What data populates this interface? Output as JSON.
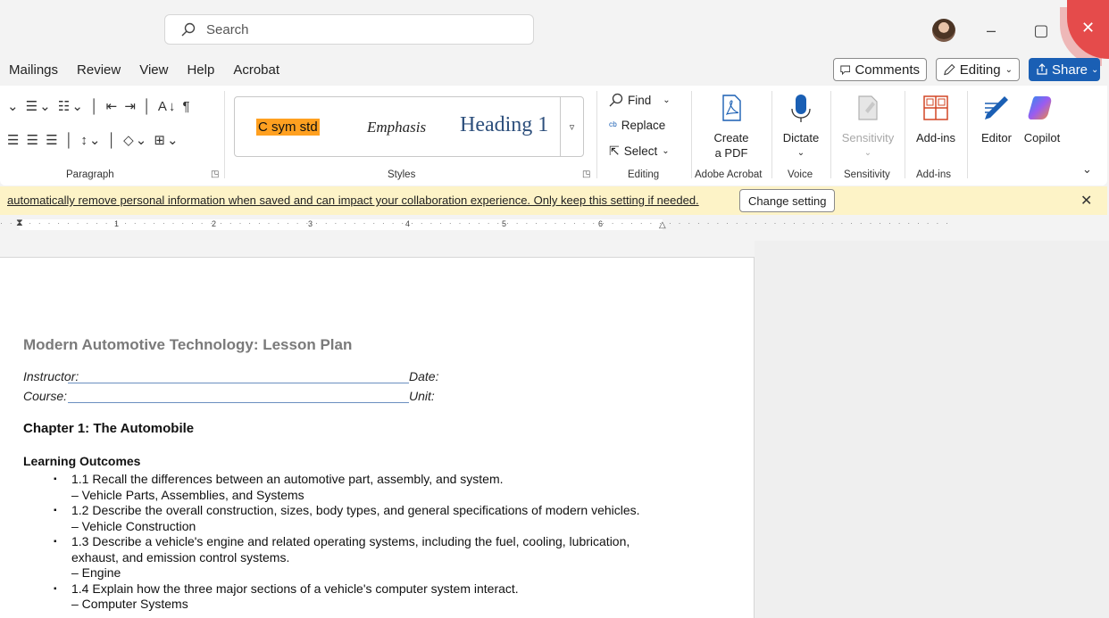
{
  "titlebar": {
    "search_placeholder": "Search",
    "minimize": "–",
    "maximize": "▢",
    "close": "✕"
  },
  "menu": {
    "items": [
      "Mailings",
      "Review",
      "View",
      "Help",
      "Acrobat"
    ],
    "comments": "Comments",
    "editing": "Editing",
    "share": "Share"
  },
  "ribbon": {
    "paragraph_label": "Paragraph",
    "styles_label": "Styles",
    "styles": [
      "C sym std",
      "Emphasis",
      "Heading 1"
    ],
    "editing_label": "Editing",
    "find": "Find",
    "replace": "Replace",
    "select": "Select",
    "create_pdf": [
      "Create",
      "a PDF"
    ],
    "adobe_label": "Adobe Acrobat",
    "dictate": "Dictate",
    "voice_label": "Voice",
    "sensitivity": "Sensitivity",
    "sensitivity_label": "Sensitivity",
    "addins": "Add-ins",
    "addins_label": "Add-ins",
    "editor": "Editor",
    "copilot": "Copilot",
    "colors": {
      "accent": "#1a5fb4",
      "highlight": "#ffa020",
      "close": "#e54b4b"
    }
  },
  "infobar": {
    "message": "automatically remove personal information when saved and can impact your collaboration experience. Only keep this setting if needed.",
    "button": "Change setting",
    "close": "✕"
  },
  "ruler": {
    "numbers": [
      "1",
      "2",
      "3",
      "4",
      "5",
      "6"
    ]
  },
  "document": {
    "title": "Modern Automotive Technology: Lesson Plan",
    "instructor": "Instructor:",
    "date": "Date:",
    "course": "Course:",
    "unit": "Unit:",
    "chapter": "Chapter 1: The Automobile",
    "learning_outcomes": "Learning Outcomes",
    "outcomes": [
      {
        "text": "1.1 Recall the differences between an automotive part, assembly, and system.",
        "sub": "– Vehicle Parts, Assemblies, and Systems"
      },
      {
        "text": "1.2 Describe the overall construction, sizes, body types, and general specifications of modern vehicles.",
        "sub": "– Vehicle Construction"
      },
      {
        "text": "1.3 Describe a vehicle's engine and related operating systems, including the fuel, cooling, lubrication, exhaust, and emission control systems.",
        "sub": "– Engine"
      },
      {
        "text": "1.4 Explain how the three major sections of a vehicle's computer system interact.",
        "sub": "– Computer Systems"
      }
    ]
  }
}
